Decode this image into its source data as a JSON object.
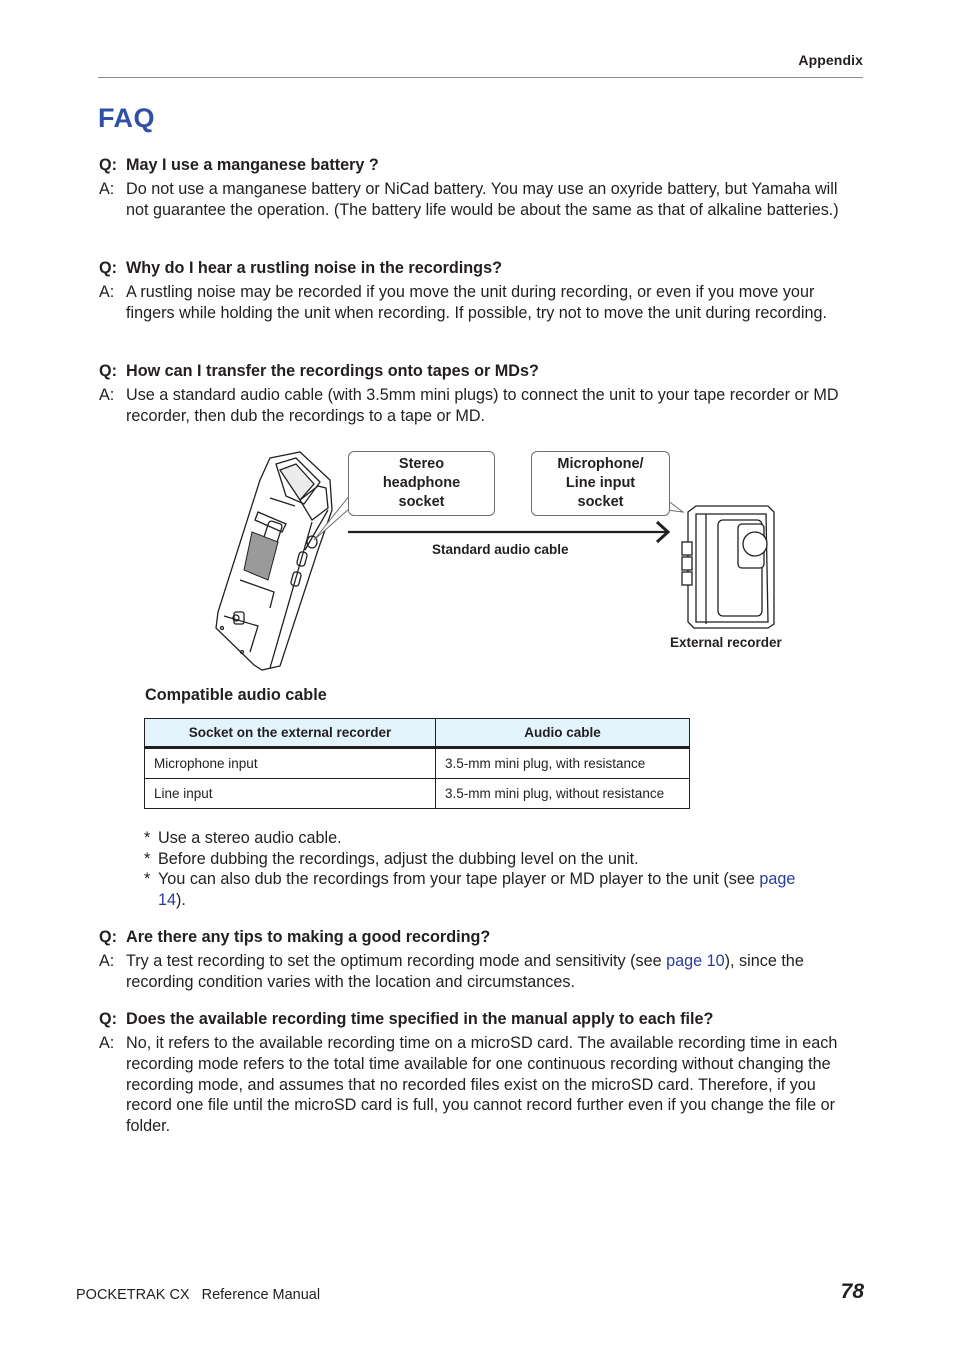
{
  "header": {
    "section": "Appendix",
    "title": "FAQ"
  },
  "faq": [
    {
      "q_prefix": "Q:",
      "question": "May I use a manganese battery ?",
      "a_prefix": "A:",
      "answer": "Do not use a manganese battery or NiCad battery. You may use an oxyride battery, but Yamaha will not guarantee the operation. (The battery life would be about the same as that of alkaline batteries.)"
    },
    {
      "q_prefix": "Q:",
      "question": "Why do I hear a rustling noise in the recordings?",
      "a_prefix": "A:",
      "answer": "A rustling noise may be recorded if you move the unit during recording, or even if you move your fingers while holding the unit when recording. If possible, try not to move the unit during recording."
    },
    {
      "q_prefix": "Q:",
      "question": "How can I transfer the recordings onto tapes or MDs?",
      "a_prefix": "A:",
      "answer": "Use a standard audio cable (with 3.5mm mini plugs) to connect the unit to your tape recorder or MD recorder, then dub the recordings to a tape or MD."
    },
    {
      "q_prefix": "Q:",
      "question": "Are there any tips to making a good recording?",
      "a_prefix": "A:",
      "answer_before": "Try a test recording to set the optimum recording mode and sensitivity (see ",
      "answer_link": "page 10",
      "answer_after": "), since the recording condition varies with the location and circumstances."
    },
    {
      "q_prefix": "Q:",
      "question": "Does the available recording time specified in the manual apply to each file?",
      "a_prefix": "A:",
      "answer": "No, it refers to the available recording time on a microSD card. The available recording time in each recording mode refers to the total time available for one continuous recording without changing the recording mode, and assumes that no recorded files exist on the microSD card. Therefore, if you record one file until the microSD card is full, you cannot record further even if you change the file or folder."
    }
  ],
  "diagram": {
    "callout_headphone": [
      "Stereo",
      "headphone",
      "socket"
    ],
    "callout_input": [
      "Microphone/",
      "Line input",
      "socket"
    ],
    "cable_label": "Standard audio cable",
    "recorder_label": "External recorder",
    "icons": [
      "pocketrak-device-illustration",
      "arrow-right-icon",
      "external-recorder-illustration"
    ]
  },
  "compatible_table": {
    "title": "Compatible audio cable",
    "headers": [
      "Socket on the external recorder",
      "Audio cable"
    ],
    "rows": [
      [
        "Microphone input",
        "3.5-mm mini plug, with resistance"
      ],
      [
        "Line input",
        "3.5-mm mini plug, without resistance"
      ]
    ]
  },
  "notes": {
    "bullet": "*",
    "items": [
      "Use a stereo audio cable.",
      "Before dubbing the recordings, adjust the dubbing level on the unit.",
      "You can also dub the recordings from your tape player or MD player to the unit (see "
    ],
    "item3_link": "page 14",
    "item3_after": ")."
  },
  "footer": {
    "product": "POCKETRAK CX",
    "doc": "Reference Manual",
    "page": "78"
  },
  "colors": {
    "title_blue": "#2f50a8",
    "link_blue": "#2b3a9b",
    "table_header_bg": "#e3f4fc"
  }
}
